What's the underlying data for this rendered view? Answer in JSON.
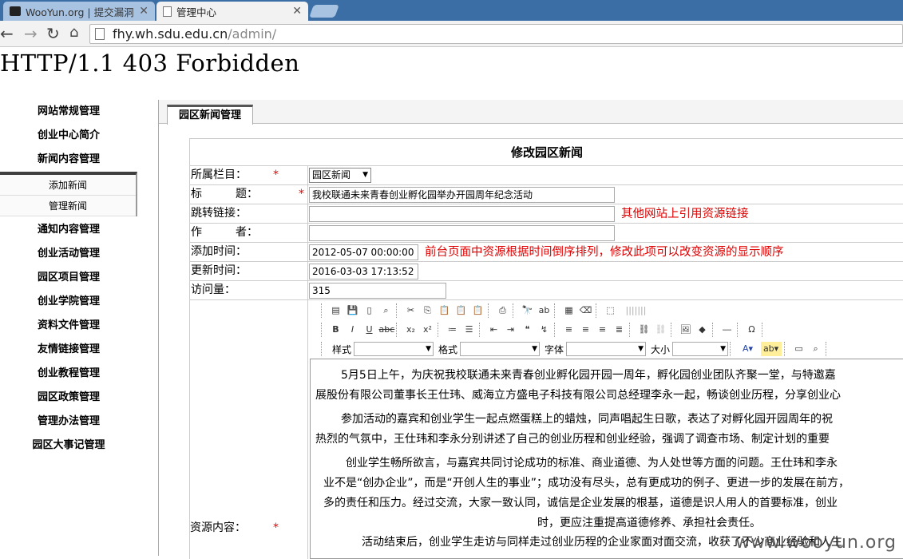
{
  "browser": {
    "tabs": [
      {
        "title": "WooYun.org | 提交漏洞"
      },
      {
        "title": "管理中心"
      }
    ],
    "url_host": "fhy.wh.sdu.edu.cn",
    "url_path": "/admin/"
  },
  "forbidden_text": "HTTP/1.1 403 Forbidden",
  "sidebar": {
    "items_top": [
      "网站常规管理",
      "创业中心简介",
      "新闻内容管理"
    ],
    "sub_items": [
      "添加新闻",
      "管理新闻"
    ],
    "items_bottom": [
      "通知内容管理",
      "创业活动管理",
      "园区项目管理",
      "创业学院管理",
      "资料文件管理",
      "友情链接管理",
      "创业教程管理",
      "园区政策管理",
      "管理办法管理",
      "园区大事记管理"
    ]
  },
  "content_tab": "园区新闻管理",
  "form": {
    "title": "修改园区新闻",
    "required_mark": "*",
    "category_label": "所属栏目：",
    "category_value": "园区新闻",
    "title_label": "标　　　题：",
    "title_value": "我校联通未来青春创业孵化园举办开园周年纪念活动",
    "link_label": "跳转链接：",
    "link_value": "",
    "link_hint": "其他网站上引用资源链接",
    "author_label": "作　　　者：",
    "author_value": "",
    "add_time_label": "添加时间：",
    "add_time_value": "2012-05-07 00:00:00",
    "add_time_hint": "前台页面中资源根据时间倒序排列，修改此项可以改变资源的显示顺序",
    "update_time_label": "更新时间：",
    "update_time_value": "2016-03-03 17:13:52",
    "views_label": "访问量：",
    "views_value": "315",
    "content_label": "资源内容："
  },
  "editor": {
    "style_label": "样式",
    "format_label": "格式",
    "font_label": "字体",
    "size_label": "大小",
    "paragraphs": [
      "5月5日上午，为庆祝我校联通未来青春创业孵化园开园一周年，孵化园创业团队齐聚一堂，与特邀嘉",
      "展股份有限公司董事长王仕玮、威海立方盛电子科技有限公司总经理李永一起，畅谈创业历程，分享创业心",
      "参加活动的嘉宾和创业学生一起点燃蛋糕上的蜡烛，同声唱起生日歌，表达了对孵化园开园周年的祝",
      "热烈的气氛中，王仕玮和李永分别讲述了自己的创业历程和创业经验，强调了调查市场、制定计划的重要",
      "创业学生畅所欲言，与嘉宾共同讨论成功的标准、商业道德、为人处世等方面的问题。王仕玮和李永",
      "业不是“创办企业”，而是“开创人生的事业”；成功没有尽头，总有更成功的例子、更进一步的发展在前方，",
      "多的责任和压力。经过交流，大家一致认同，诚信是企业发展的根基，道德是识人用人的首要标准，创业",
      "时，更应注重提高道德修养、承担社会责任。",
      "活动结束后，创业学生走访与同样走过创业历程的企业家面对面交流，收获了不少商业经验和人生"
    ]
  },
  "watermark": "www.wooyun.org"
}
